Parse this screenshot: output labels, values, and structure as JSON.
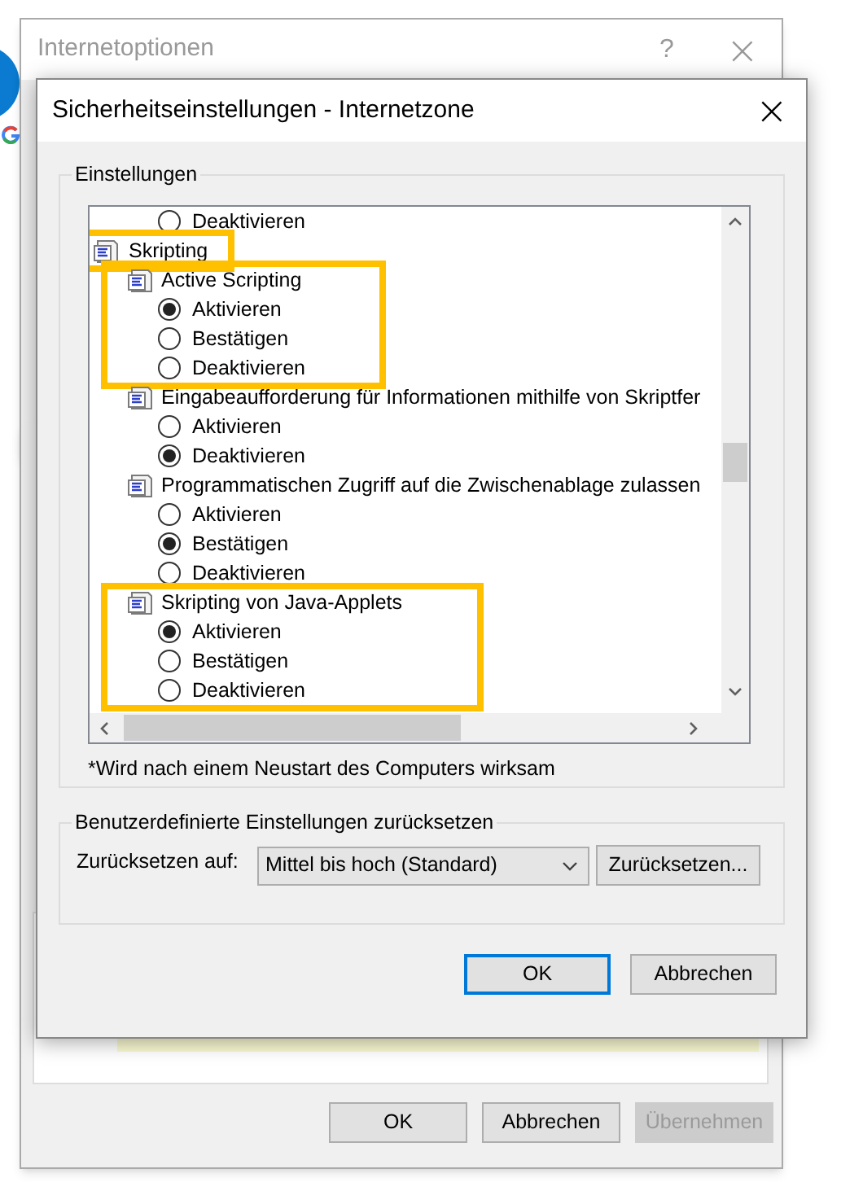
{
  "back_window": {
    "title": "Internetoptionen",
    "help": "?",
    "close": "×",
    "buttons": [
      {
        "label": "OK",
        "disabled": false
      },
      {
        "label": "Abbrechen",
        "disabled": false
      },
      {
        "label": "Übernehmen",
        "disabled": true
      }
    ]
  },
  "dialog": {
    "title": "Sicherheitseinstellungen - Internetzone",
    "close": "×",
    "settings_group": {
      "legend": "Einstellungen",
      "items": [
        {
          "kind": "option",
          "label": "Deaktivieren",
          "selected": false
        },
        {
          "kind": "category",
          "label": "Skripting",
          "highlighted": true,
          "children": [
            {
              "kind": "setting",
              "label": "Active Scripting",
              "highlighted": true,
              "children": [
                {
                  "kind": "option",
                  "label": "Aktivieren",
                  "selected": true
                },
                {
                  "kind": "option",
                  "label": "Bestätigen",
                  "selected": false
                },
                {
                  "kind": "option",
                  "label": "Deaktivieren",
                  "selected": false
                }
              ]
            },
            {
              "kind": "setting",
              "label": "Eingabeaufforderung für Informationen mithilfe von Skriptfer",
              "highlighted": false,
              "children": [
                {
                  "kind": "option",
                  "label": "Aktivieren",
                  "selected": false
                },
                {
                  "kind": "option",
                  "label": "Deaktivieren",
                  "selected": true
                }
              ]
            },
            {
              "kind": "setting",
              "label": "Programmatischen Zugriff auf die Zwischenablage zulassen",
              "highlighted": false,
              "children": [
                {
                  "kind": "option",
                  "label": "Aktivieren",
                  "selected": false
                },
                {
                  "kind": "option",
                  "label": "Bestätigen",
                  "selected": true
                },
                {
                  "kind": "option",
                  "label": "Deaktivieren",
                  "selected": false
                }
              ]
            },
            {
              "kind": "setting",
              "label": "Skripting von Java-Applets",
              "highlighted": true,
              "children": [
                {
                  "kind": "option",
                  "label": "Aktivieren",
                  "selected": true
                },
                {
                  "kind": "option",
                  "label": "Bestätigen",
                  "selected": false
                },
                {
                  "kind": "option",
                  "label": "Deaktivieren",
                  "selected": false
                }
              ]
            }
          ]
        }
      ],
      "footnote": "*Wird nach einem Neustart des Computers wirksam"
    },
    "reset_group": {
      "legend": "Benutzerdefinierte Einstellungen zurücksetzen",
      "label": "Zurücksetzen auf:",
      "value": "Mittel bis hoch (Standard)",
      "button": "Zurücksetzen..."
    },
    "buttons": [
      {
        "label": "OK",
        "default": true
      },
      {
        "label": "Abbrechen",
        "default": false
      }
    ]
  }
}
